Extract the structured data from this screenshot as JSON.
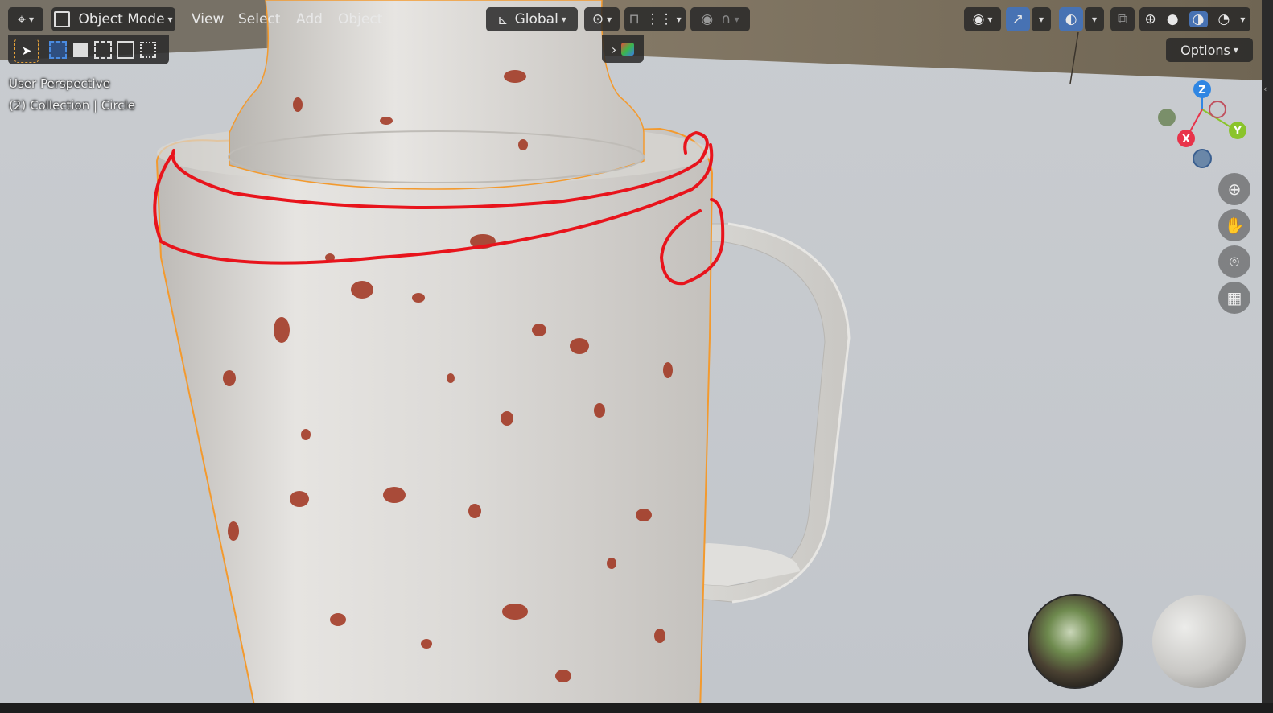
{
  "header": {
    "mode_label": "Object Mode",
    "menus": [
      "View",
      "Select",
      "Add",
      "Object"
    ],
    "orientation_label": "Global",
    "options_label": "Options"
  },
  "viewport": {
    "perspective_label": "User Perspective",
    "collection_label": "(2) Collection | Circle"
  },
  "gizmo": {
    "axes": {
      "x": "X",
      "y": "Y",
      "z": "Z"
    },
    "colors": {
      "x": "#e8334a",
      "y": "#8ac42b",
      "z": "#2f86e3"
    }
  },
  "colors": {
    "accent": "#4772b3",
    "selection_outline": "#f39a2e",
    "annotation": "#e8141c",
    "rust": "#a0321d"
  },
  "icons": {
    "editor_type": "editor-type-icon",
    "nav": [
      "zoom-icon",
      "pan-hand-icon",
      "camera-icon",
      "grid-icon"
    ]
  }
}
